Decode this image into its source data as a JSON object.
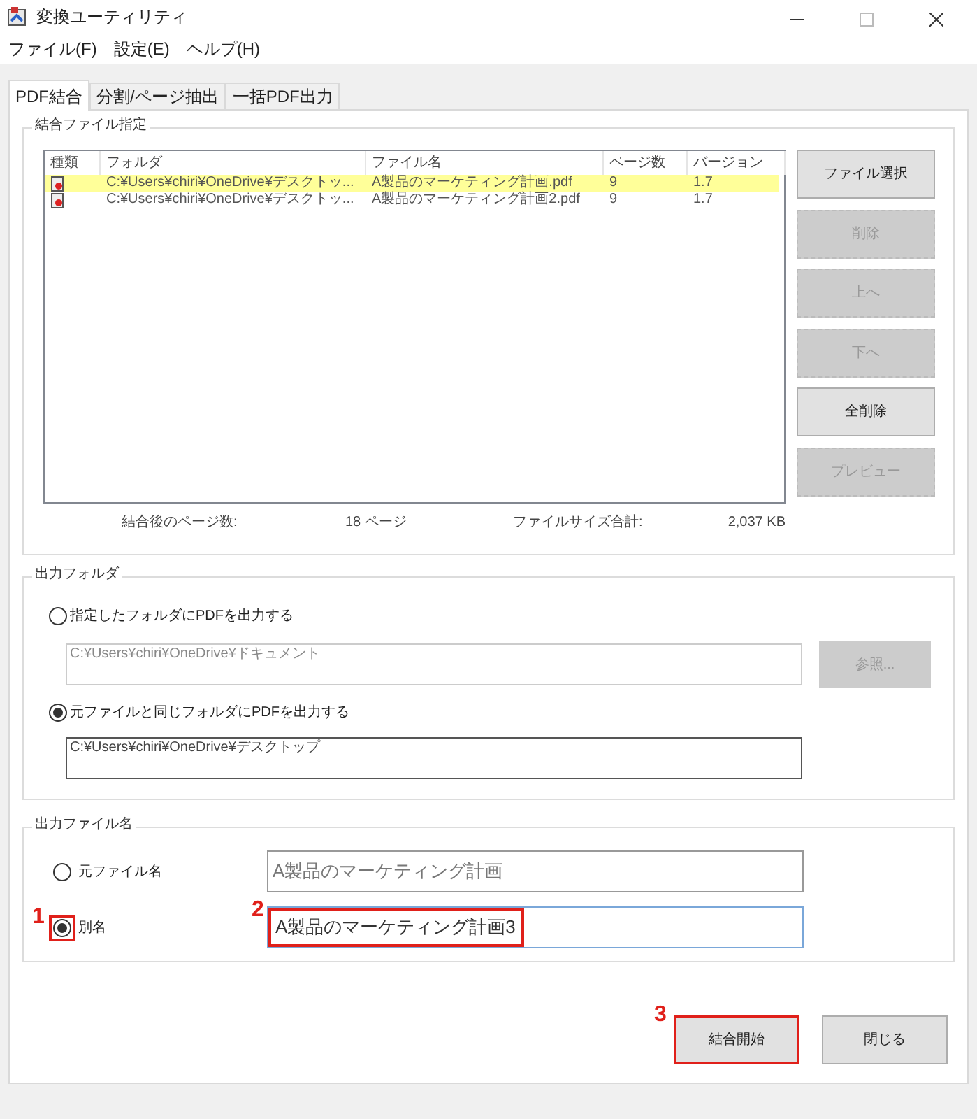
{
  "window": {
    "title": "変換ユーティリティ"
  },
  "menu": [
    "ファイル(F)",
    "設定(E)",
    "ヘルプ(H)"
  ],
  "tabs": [
    {
      "label": "PDF結合",
      "selected": true
    },
    {
      "label": "分割/ページ抽出",
      "selected": false
    },
    {
      "label": "一括PDF出力",
      "selected": false
    }
  ],
  "merge_files": {
    "title": "結合ファイル指定",
    "columns": [
      "種類",
      "フォルダ",
      "ファイル名",
      "ページ数",
      "バージョン"
    ],
    "rows": [
      {
        "folder": "C:¥Users¥chiri¥OneDrive¥デスクトッ...",
        "file": "A製品のマーケティング計画.pdf",
        "pages": "9",
        "version": "1.7",
        "selected": true
      },
      {
        "folder": "C:¥Users¥chiri¥OneDrive¥デスクトッ...",
        "file": "A製品のマーケティング計画2.pdf",
        "pages": "9",
        "version": "1.7",
        "selected": false
      }
    ],
    "buttons": [
      {
        "label": "ファイル選択",
        "disabled": false
      },
      {
        "label": "削除",
        "disabled": true
      },
      {
        "label": "上へ",
        "disabled": true
      },
      {
        "label": "下へ",
        "disabled": true
      },
      {
        "label": "全削除",
        "disabled": false
      },
      {
        "label": "プレビュー",
        "disabled": true
      }
    ],
    "summary": {
      "pages_label": "結合後のページ数:",
      "pages_value": "18 ページ",
      "size_label": "ファイルサイズ合計:",
      "size_value": "2,037 KB"
    }
  },
  "output_folder": {
    "title": "出力フォルダ",
    "options": [
      {
        "label": "指定したフォルダにPDFを出力する",
        "selected": false,
        "path": "C:¥Users¥chiri¥OneDrive¥ドキュメント",
        "path_disabled": true,
        "browse": {
          "label": "参照...",
          "disabled": true
        }
      },
      {
        "label": "元ファイルと同じフォルダにPDFを出力する",
        "selected": true,
        "path": "C:¥Users¥chiri¥OneDrive¥デスクトップ",
        "path_disabled": false
      }
    ]
  },
  "output_filename": {
    "title": "出力ファイル名",
    "options": [
      {
        "label": "元ファイル名",
        "selected": false,
        "value": "A製品のマーケティング計画",
        "disabled": true
      },
      {
        "label": "別名",
        "selected": true,
        "value": "A製品のマーケティング計画3",
        "disabled": false,
        "radio_marker": "1",
        "field_marker": "2"
      }
    ]
  },
  "footer_buttons": [
    {
      "label": "結合開始",
      "marker": "3"
    },
    {
      "label": "閉じる"
    }
  ]
}
